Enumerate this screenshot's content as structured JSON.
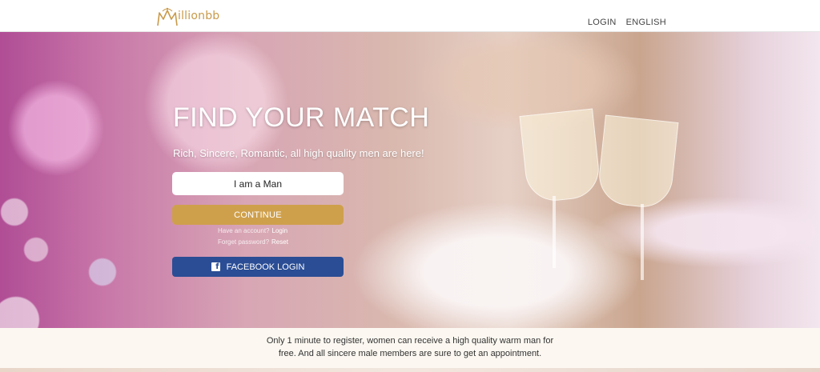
{
  "header": {
    "logo_text": "illionbb",
    "nav": {
      "login": "LOGIN",
      "language": "ENGLISH"
    }
  },
  "hero": {
    "headline": "FIND YOUR MATCH",
    "subline": "Rich, Sincere, Romantic, all high quality men are here!",
    "gender_select": {
      "value": "I am a Man"
    },
    "continue_label": "CONTINUE",
    "have_account_text": "Have an account?",
    "login_link": "Login",
    "forgot_text": "Forget password?",
    "reset_link": "Reset",
    "facebook_label": "FACEBOOK LOGIN",
    "facebook_icon": "f"
  },
  "footer": {
    "tagline_line1": "Only 1 minute to register, women can receive a high quality warm man for",
    "tagline_line2": "free. And all sincere male members are sure to get an appointment."
  },
  "colors": {
    "brand": "#c99a4a",
    "continue_button": "#cfa04c",
    "facebook_button": "#2a4d95"
  }
}
